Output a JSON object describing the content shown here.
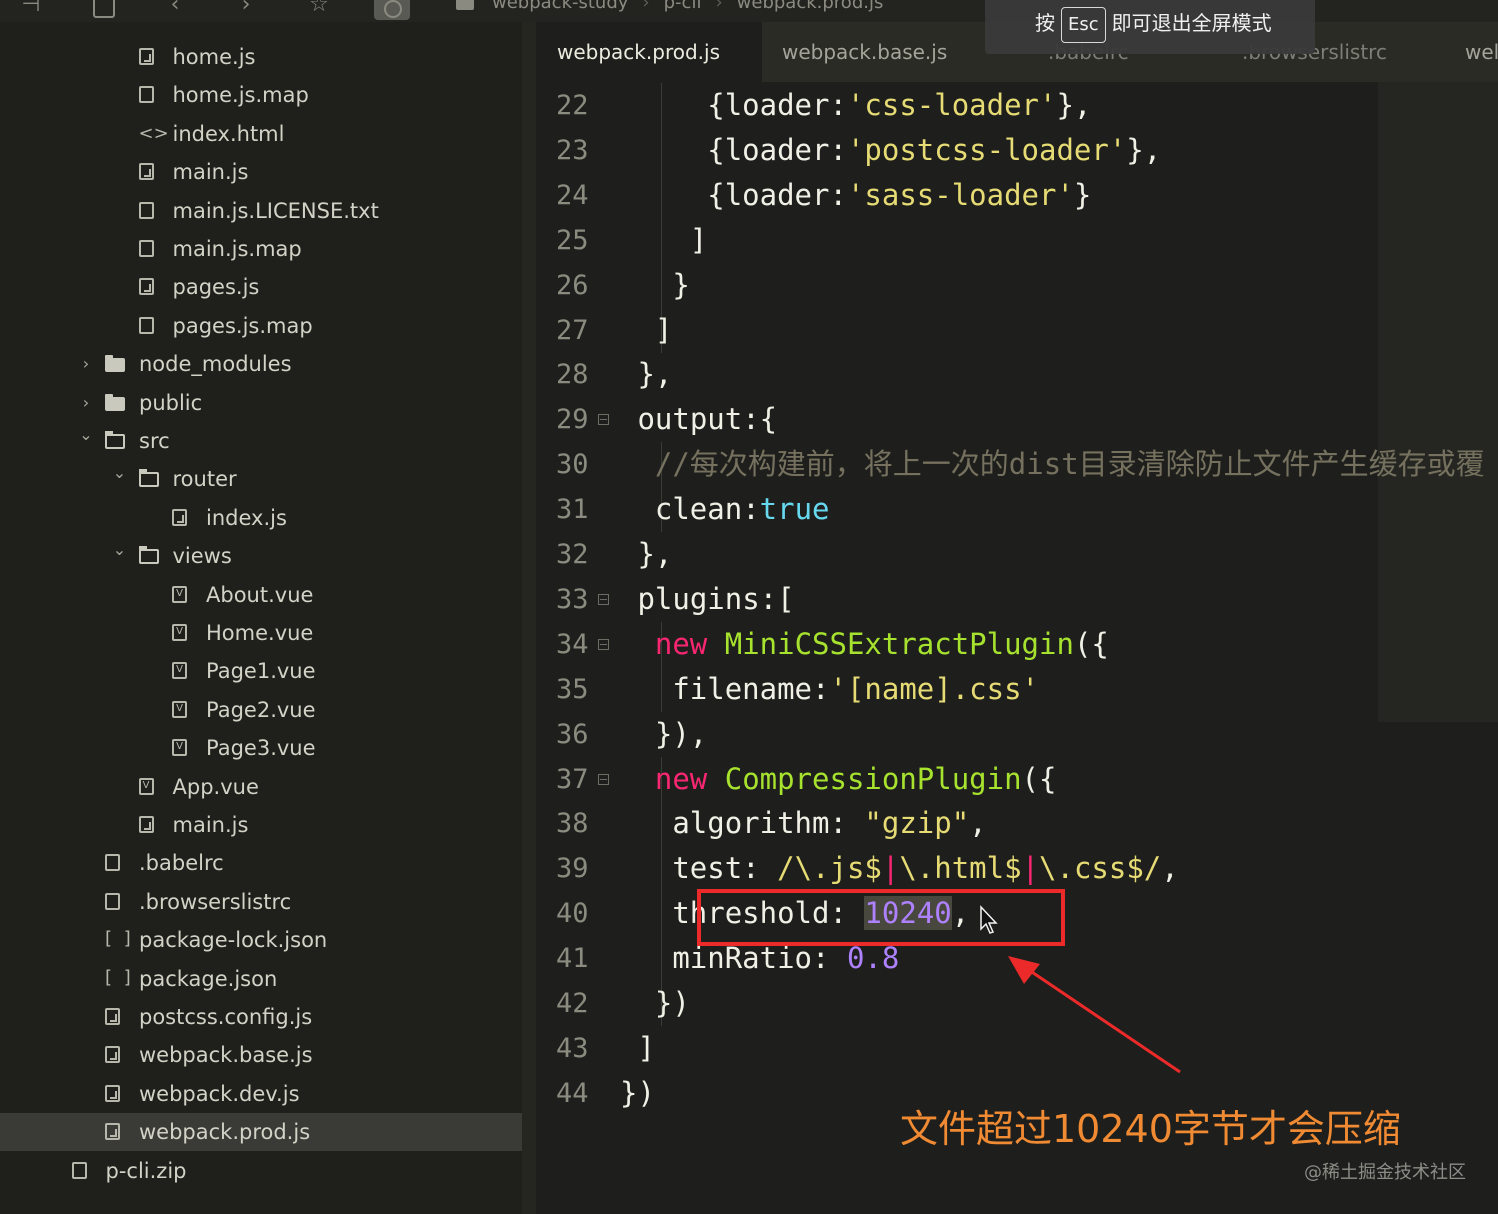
{
  "toolbar": {
    "breadcrumb": [
      "webpack-study",
      "p-cli",
      "webpack.prod.js"
    ]
  },
  "fullscreen_hint": {
    "press": "按",
    "key": "Esc",
    "text": "即可退出全屏模式"
  },
  "sidebar": {
    "items": [
      {
        "label": "home.js",
        "icon": "js-file-icon",
        "chevron": ""
      },
      {
        "label": "home.js.map",
        "icon": "file-icon",
        "chevron": ""
      },
      {
        "label": "index.html",
        "icon": "html-file-icon",
        "chevron": ""
      },
      {
        "label": "main.js",
        "icon": "js-file-icon",
        "chevron": ""
      },
      {
        "label": "main.js.LICENSE.txt",
        "icon": "file-icon",
        "chevron": ""
      },
      {
        "label": "main.js.map",
        "icon": "file-icon",
        "chevron": ""
      },
      {
        "label": "pages.js",
        "icon": "js-file-icon",
        "chevron": ""
      },
      {
        "label": "pages.js.map",
        "icon": "file-icon",
        "chevron": ""
      },
      {
        "label": "node_modules",
        "icon": "folder-icon",
        "chevron": "›"
      },
      {
        "label": "public",
        "icon": "folder-icon",
        "chevron": "›"
      },
      {
        "label": "src",
        "icon": "folder-open-icon",
        "chevron": "⌄"
      },
      {
        "label": "router",
        "icon": "folder-open-icon",
        "chevron": "⌄"
      },
      {
        "label": "index.js",
        "icon": "js-file-icon",
        "chevron": ""
      },
      {
        "label": "views",
        "icon": "folder-open-icon",
        "chevron": "⌄"
      },
      {
        "label": "About.vue",
        "icon": "vue-file-icon",
        "chevron": ""
      },
      {
        "label": "Home.vue",
        "icon": "vue-file-icon",
        "chevron": ""
      },
      {
        "label": "Page1.vue",
        "icon": "vue-file-icon",
        "chevron": ""
      },
      {
        "label": "Page2.vue",
        "icon": "vue-file-icon",
        "chevron": ""
      },
      {
        "label": "Page3.vue",
        "icon": "vue-file-icon",
        "chevron": ""
      },
      {
        "label": "App.vue",
        "icon": "vue-file-icon",
        "chevron": ""
      },
      {
        "label": "main.js",
        "icon": "js-file-icon",
        "chevron": ""
      },
      {
        "label": ".babelrc",
        "icon": "file-icon",
        "chevron": ""
      },
      {
        "label": ".browserslistrc",
        "icon": "file-icon",
        "chevron": ""
      },
      {
        "label": "package-lock.json",
        "icon": "json-file-icon",
        "chevron": ""
      },
      {
        "label": "package.json",
        "icon": "json-file-icon",
        "chevron": ""
      },
      {
        "label": "postcss.config.js",
        "icon": "js-file-icon",
        "chevron": ""
      },
      {
        "label": "webpack.base.js",
        "icon": "js-file-icon",
        "chevron": ""
      },
      {
        "label": "webpack.dev.js",
        "icon": "js-file-icon",
        "chevron": ""
      },
      {
        "label": "webpack.prod.js",
        "icon": "js-file-icon",
        "chevron": "",
        "selected": true
      },
      {
        "label": "p-cli.zip",
        "icon": "file-icon",
        "chevron": ""
      }
    ]
  },
  "tabs": [
    {
      "label": "webpack.prod.js",
      "active": true
    },
    {
      "label": "webpack.base.js",
      "active": false
    },
    {
      "label": ".babelrc",
      "active": false
    },
    {
      "label": ".browserslistrc",
      "active": false
    },
    {
      "label": "wel",
      "active": false
    }
  ],
  "editor": {
    "lines": [
      {
        "n": "22",
        "tokens": [
          [
            "p",
            "{loader:"
          ],
          [
            "s",
            "'css-loader'"
          ],
          [
            "p",
            "},"
          ]
        ]
      },
      {
        "n": "23",
        "tokens": [
          [
            "p",
            "{loader:"
          ],
          [
            "s",
            "'postcss-loader'"
          ],
          [
            "p",
            "},"
          ]
        ]
      },
      {
        "n": "24",
        "tokens": [
          [
            "p",
            "{loader:"
          ],
          [
            "s",
            "'sass-loader'"
          ],
          [
            "p",
            "}"
          ]
        ]
      },
      {
        "n": "25",
        "tokens": [
          [
            "p",
            "]"
          ]
        ]
      },
      {
        "n": "26",
        "tokens": [
          [
            "p",
            "}"
          ]
        ]
      },
      {
        "n": "27",
        "tokens": [
          [
            "p",
            "]"
          ]
        ]
      },
      {
        "n": "28",
        "tokens": [
          [
            "p",
            "},"
          ]
        ]
      },
      {
        "n": "29",
        "tokens": [
          [
            "p",
            "output:{"
          ]
        ]
      },
      {
        "n": "30",
        "tokens": [
          [
            "c",
            "//每次构建前，将上一次的dist目录清除防止文件产生缓存或覆"
          ]
        ]
      },
      {
        "n": "31",
        "tokens": [
          [
            "p",
            "clean:"
          ],
          [
            "b",
            "true"
          ]
        ]
      },
      {
        "n": "32",
        "tokens": [
          [
            "p",
            "},"
          ]
        ]
      },
      {
        "n": "33",
        "tokens": [
          [
            "p",
            "plugins:["
          ]
        ]
      },
      {
        "n": "34",
        "tokens": [
          [
            "k",
            "new "
          ],
          [
            "f",
            "MiniCSSExtractPlugin"
          ],
          [
            "p",
            "({"
          ]
        ]
      },
      {
        "n": "35",
        "tokens": [
          [
            "p",
            "filename:"
          ],
          [
            "s",
            "'[name].css'"
          ]
        ]
      },
      {
        "n": "36",
        "tokens": [
          [
            "p",
            "}),"
          ]
        ]
      },
      {
        "n": "37",
        "tokens": [
          [
            "k",
            "new "
          ],
          [
            "f",
            "CompressionPlugin"
          ],
          [
            "p",
            "({"
          ]
        ]
      },
      {
        "n": "38",
        "tokens": [
          [
            "p",
            "algorithm: "
          ],
          [
            "s",
            "\"gzip\""
          ],
          [
            "p",
            ","
          ]
        ]
      },
      {
        "n": "39",
        "tokens": [
          [
            "p",
            "test: "
          ],
          [
            "s",
            "/\\.js$"
          ],
          [
            "k",
            "|"
          ],
          [
            "s",
            "\\.html$"
          ],
          [
            "k",
            "|"
          ],
          [
            "s",
            "\\.css$/"
          ],
          [
            "p",
            ","
          ]
        ]
      },
      {
        "n": "40",
        "tokens": [
          [
            "p",
            "threshold: "
          ],
          [
            "nsel",
            "10240"
          ],
          [
            "p",
            ","
          ]
        ]
      },
      {
        "n": "41",
        "tokens": [
          [
            "p",
            "minRatio: "
          ],
          [
            "n",
            "0.8"
          ]
        ]
      },
      {
        "n": "42",
        "tokens": [
          [
            "p",
            "})"
          ]
        ]
      },
      {
        "n": "43",
        "tokens": [
          [
            "p",
            "]"
          ]
        ]
      },
      {
        "n": "44",
        "tokens": [
          [
            "p",
            "})"
          ]
        ]
      }
    ]
  },
  "annotation": {
    "text": "文件超过10240字节才会压缩",
    "color": "#f08a33",
    "box_color": "#ec2a2a"
  },
  "watermark": "@稀土掘金技术社区"
}
